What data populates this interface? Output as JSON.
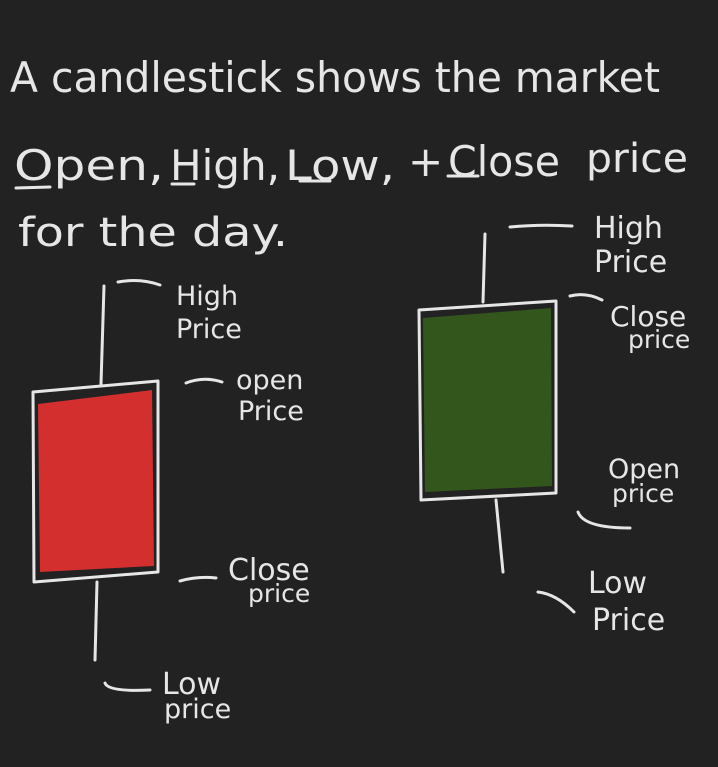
{
  "header": {
    "line1": "A candlestick shows the market",
    "word_open": "Open,",
    "word_high": "High,",
    "word_low": "Low,",
    "word_plus": "+",
    "word_close": "Close",
    "word_price": "price",
    "line3": "for the day."
  },
  "bearish_candle": {
    "fill_color": "#d32f2f",
    "labels": {
      "high_1": "High",
      "high_2": "Price",
      "open_1": "open",
      "open_2": "Price",
      "close_1": "Close",
      "close_2": "price",
      "low_1": "Low",
      "low_2": "price"
    }
  },
  "bullish_candle": {
    "fill_color": "#33561c",
    "labels": {
      "high_1": "High",
      "high_2": "Price",
      "close_1": "Close",
      "close_2": "price",
      "open_1": "Open",
      "open_2": "price",
      "low_1": "Low",
      "low_2": "Price"
    }
  },
  "colors": {
    "background": "#222222",
    "chalk": "#e6e6e6"
  }
}
